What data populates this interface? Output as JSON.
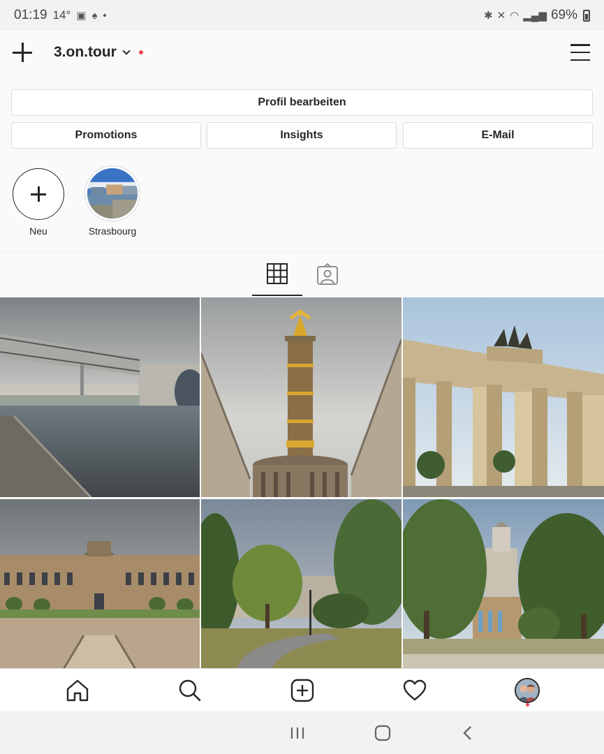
{
  "status": {
    "time": "01:19",
    "temp": "14°",
    "battery": "69%"
  },
  "header": {
    "account_name": "3.on.tour",
    "notification_dot_color": "#ed4956"
  },
  "buttons": {
    "edit_profile": "Profil bearbeiten",
    "promotions": "Promotions",
    "insights": "Insights",
    "email": "E-Mail"
  },
  "highlights": [
    {
      "label": "Neu",
      "icon": "plus-icon"
    },
    {
      "label": "Strasbourg",
      "icon": "story-thumbnail"
    }
  ],
  "tabs": [
    {
      "icon": "grid-icon",
      "active": true
    },
    {
      "icon": "tagged-icon",
      "active": false
    }
  ],
  "posts": [
    {
      "subject": "Berlin Spree with Paul-Löbe-Haus bridge"
    },
    {
      "subject": "Victory Column (Siegessäule)"
    },
    {
      "subject": "Brandenburg Gate"
    },
    {
      "subject": "Zwinger palace square"
    },
    {
      "subject": "Park with trees and road"
    },
    {
      "subject": "Frauenkirche with trees"
    }
  ],
  "bottom_nav": [
    {
      "icon": "home-icon"
    },
    {
      "icon": "search-icon"
    },
    {
      "icon": "add-post-icon"
    },
    {
      "icon": "heart-icon"
    },
    {
      "icon": "profile-avatar"
    }
  ],
  "colors": {
    "text": "#262626",
    "border": "#dbdbdb",
    "accent_red": "#ed4956"
  }
}
